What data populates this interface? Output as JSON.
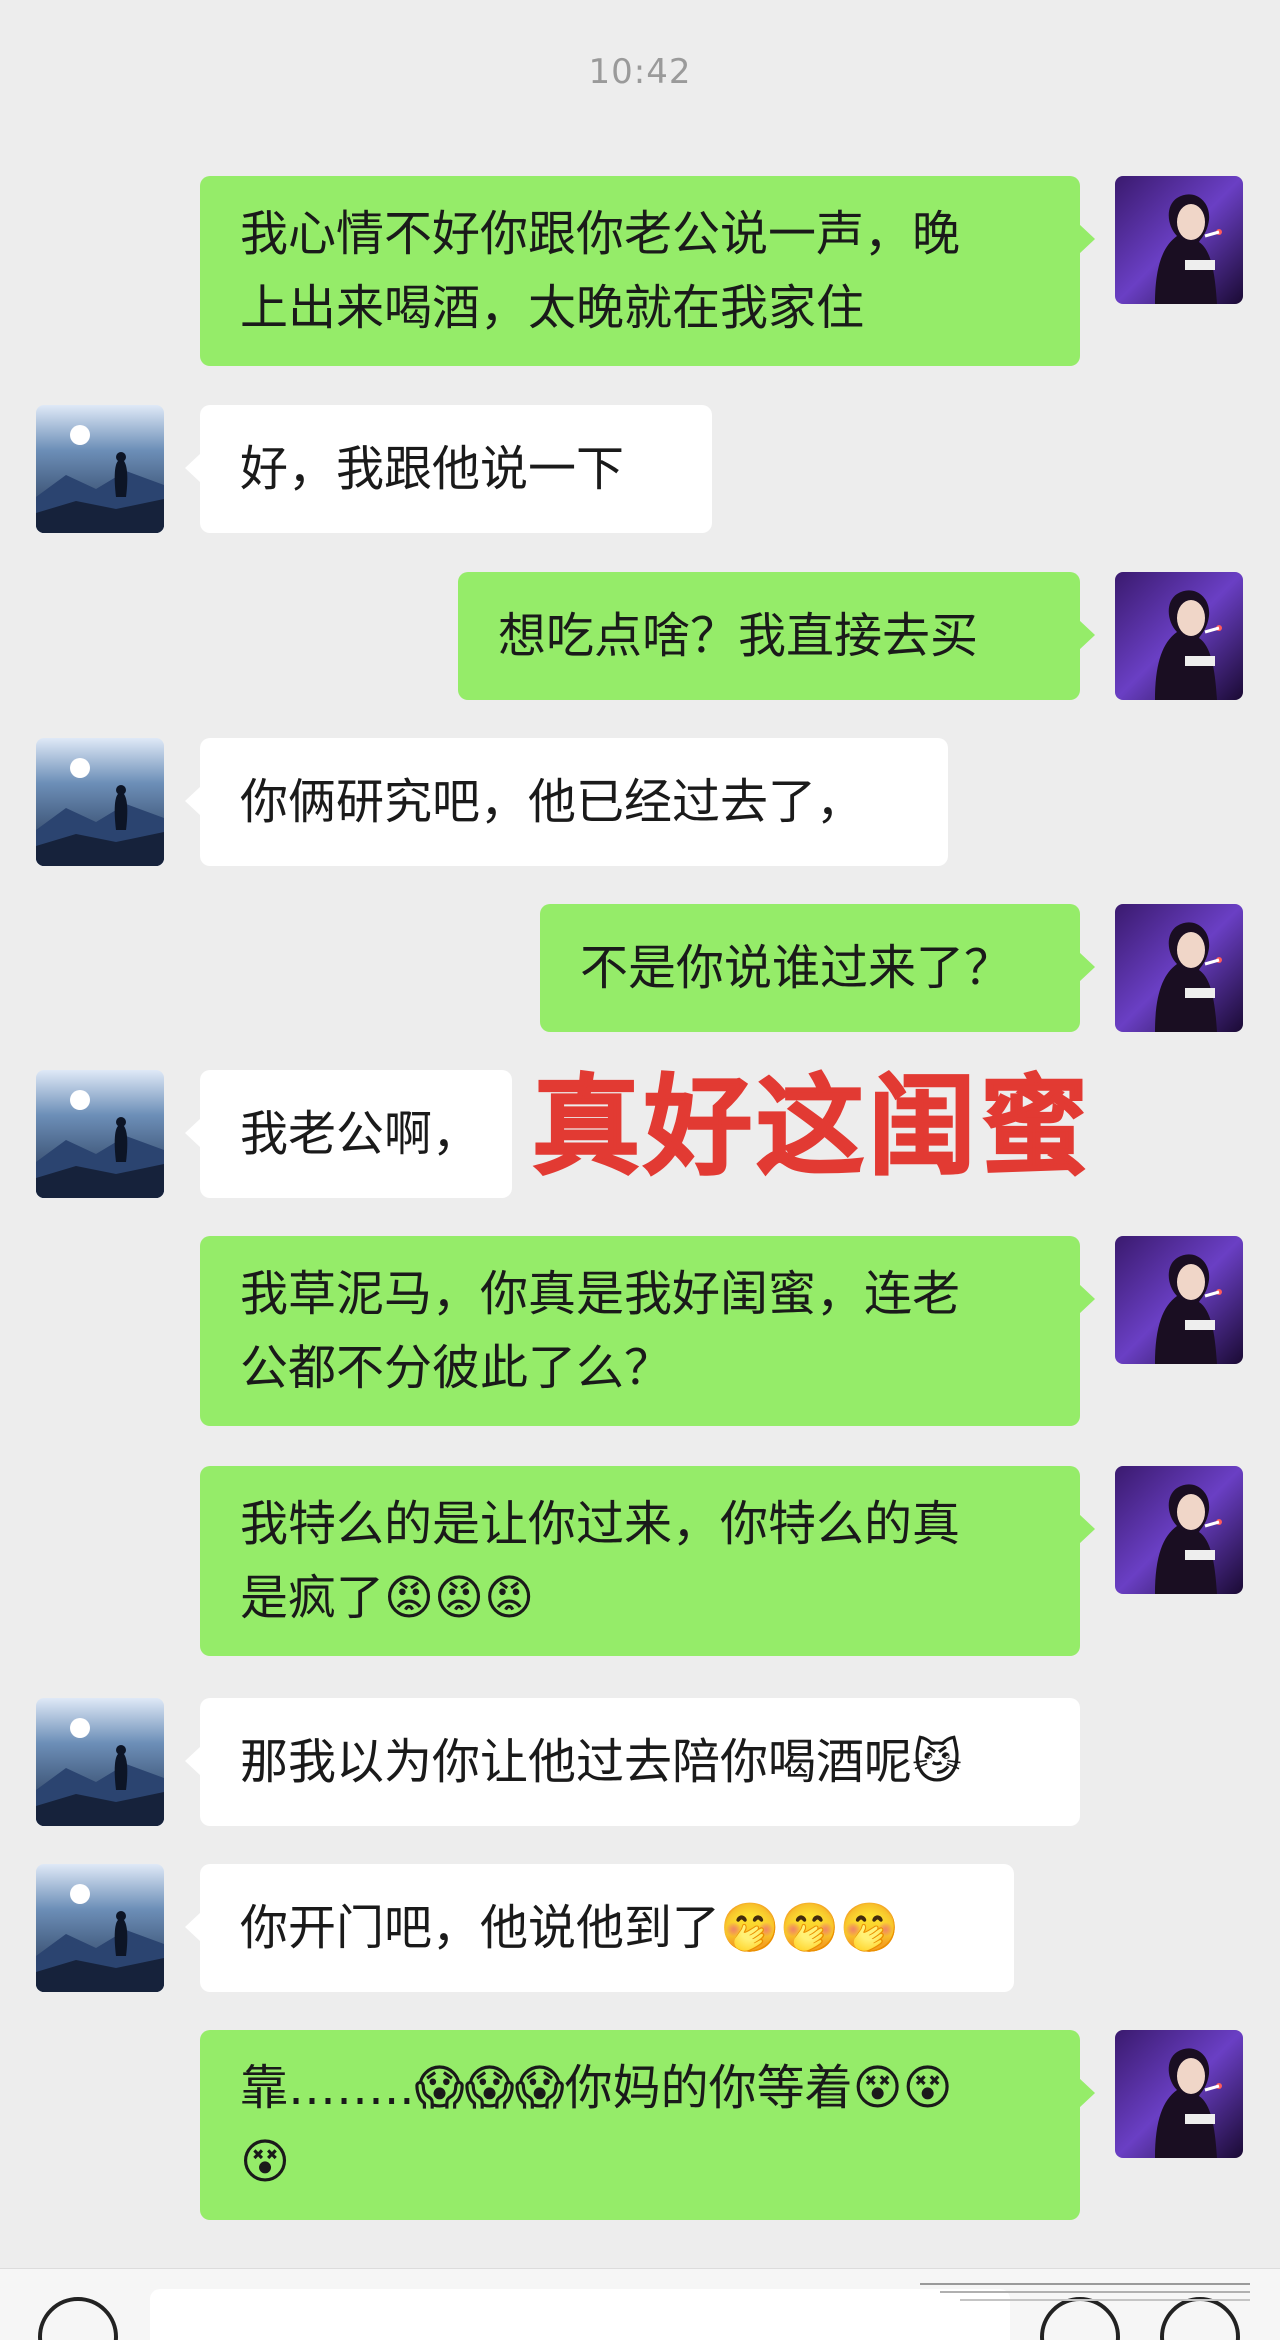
{
  "chat": {
    "timestamp": "10:42",
    "caption": "真好这闺蜜",
    "messages": [
      {
        "sender": "me",
        "lines": [
          "我心情不好你跟你老公说一声，晚",
          "上出来喝酒，太晚就在我家住"
        ]
      },
      {
        "sender": "friend",
        "lines": [
          "好，我跟他说一下"
        ]
      },
      {
        "sender": "me",
        "lines": [
          "想吃点啥？我直接去买"
        ]
      },
      {
        "sender": "friend",
        "lines": [
          "你俩研究吧，他已经过去了，"
        ]
      },
      {
        "sender": "me",
        "lines": [
          "不是你说谁过来了？"
        ]
      },
      {
        "sender": "friend",
        "lines": [
          "我老公啊，"
        ]
      },
      {
        "sender": "me",
        "lines": [
          "我草泥马，你真是我好闺蜜，连老",
          "公都不分彼此了么？"
        ]
      },
      {
        "sender": "me",
        "lines": [
          "我特么的是让你过来，你特么的真",
          "是疯了😡😡😡"
        ]
      },
      {
        "sender": "friend",
        "lines": [
          "那我以为你让他过去陪你喝酒呢😼"
        ]
      },
      {
        "sender": "friend",
        "lines": [
          "你开门吧，他说他到了🤭🤭🤭"
        ]
      },
      {
        "sender": "me",
        "lines": [
          "靠……..😱😱😱你妈的你等着😵😵",
          "😵"
        ]
      }
    ]
  },
  "avatars": {
    "me": "woman-portrait-purple-avatar",
    "friend": "moonlit-mountain-avatar"
  },
  "colors": {
    "background": "#ededed",
    "my_bubble": "#95ec69",
    "friend_bubble": "#ffffff",
    "caption": "#e23a33"
  },
  "bottom_bar": {
    "icons": [
      "voice-icon",
      "emoji-icon",
      "plus-icon"
    ]
  }
}
